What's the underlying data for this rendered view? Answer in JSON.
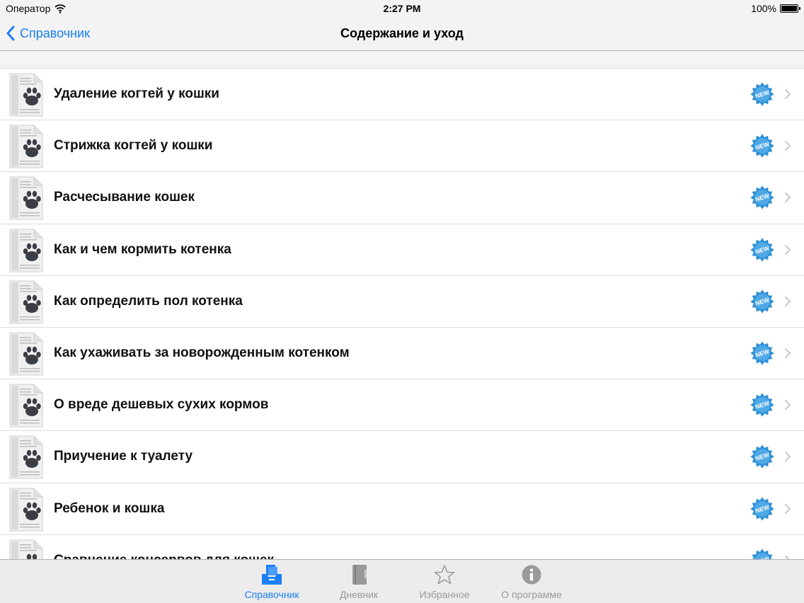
{
  "status_bar": {
    "carrier": "Оператор",
    "time": "2:27 PM",
    "battery": "100%"
  },
  "nav": {
    "back_label": "Справочник",
    "title": "Содержание и уход"
  },
  "items": [
    {
      "title": "Удаление когтей у кошки",
      "badge": "NEW"
    },
    {
      "title": "Стрижка когтей у кошки",
      "badge": "NEW"
    },
    {
      "title": "Расчесывание кошек",
      "badge": "NEW"
    },
    {
      "title": "Как и чем кормить котенка",
      "badge": "NEW"
    },
    {
      "title": "Как определить пол котенка",
      "badge": "NEW"
    },
    {
      "title": "Как ухаживать за новорожденным котенком",
      "badge": "NEW"
    },
    {
      "title": "О вреде дешевых сухих кормов",
      "badge": "NEW"
    },
    {
      "title": "Приучение к туалету",
      "badge": "NEW"
    },
    {
      "title": "Ребенок и кошка",
      "badge": "NEW"
    },
    {
      "title": "Сравнение консервов для кошек",
      "badge": "NEW"
    }
  ],
  "tabs": [
    {
      "label": "Справочник",
      "icon": "book-tray-icon",
      "active": true
    },
    {
      "label": "Дневник",
      "icon": "notebook-icon",
      "active": false
    },
    {
      "label": "Избранное",
      "icon": "star-icon",
      "active": false
    },
    {
      "label": "О программе",
      "icon": "info-icon",
      "active": false
    }
  ],
  "colors": {
    "accent": "#1a7ff5",
    "badge": "#2d8fd6",
    "inactive_tab": "#9a9a9a"
  }
}
